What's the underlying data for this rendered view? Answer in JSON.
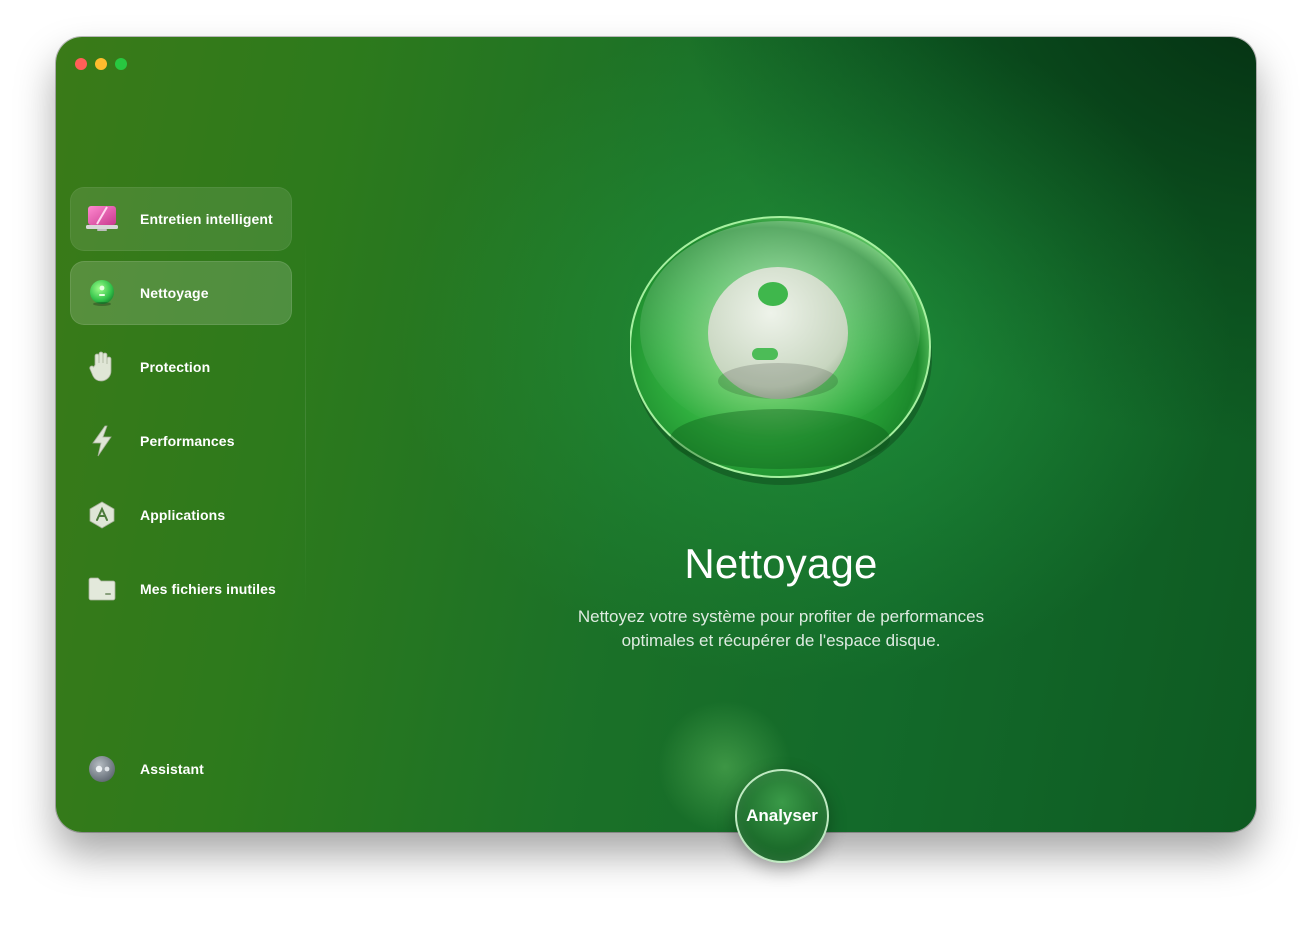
{
  "window": {
    "controls": [
      "close",
      "minimize",
      "zoom"
    ]
  },
  "sidebar": {
    "items": [
      {
        "label": "Entretien intelligent",
        "icon": "smart-care-icon",
        "state": "highlighted"
      },
      {
        "label": "Nettoyage",
        "icon": "cleanup-icon",
        "state": "selected"
      },
      {
        "label": "Protection",
        "icon": "protection-hand-icon",
        "state": "normal"
      },
      {
        "label": "Performances",
        "icon": "performance-bolt-icon",
        "state": "normal"
      },
      {
        "label": "Applications",
        "icon": "applications-icon",
        "state": "normal"
      },
      {
        "label": "Mes fichiers inutiles",
        "icon": "folder-clutter-icon",
        "state": "normal"
      }
    ],
    "assistant": {
      "label": "Assistant",
      "icon": "assistant-icon"
    }
  },
  "main": {
    "title": "Nettoyage",
    "description_line1": "Nettoyez votre système pour profiter de performances",
    "description_line2": "optimales et récupérer de l'espace disque.",
    "hero_icon": "cleanup-disc-icon",
    "scan_button": "Analyser"
  },
  "colors": {
    "accent": "#1b7128",
    "sidebar_tint": "#3a7a18",
    "dark_corner": "#032a10",
    "button_border": "#dcffdc"
  }
}
